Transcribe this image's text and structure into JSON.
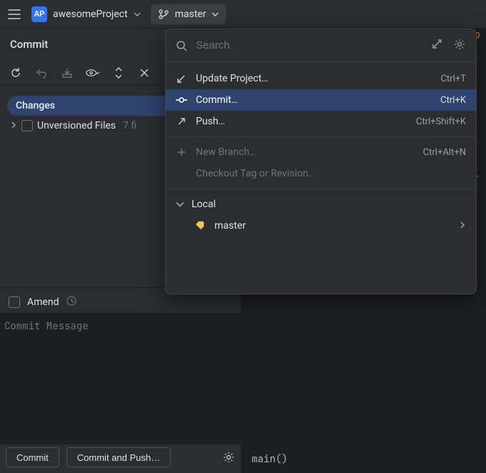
{
  "project": {
    "icon_text": "AP",
    "name": "awesomeProject"
  },
  "branch": {
    "name": "master"
  },
  "commit_panel": {
    "title": "Commit",
    "changes_label": "Changes",
    "unversioned_label": "Unversioned Files",
    "unversioned_count": "7 fi",
    "amend_label": "Amend",
    "message_placeholder": "Commit Message",
    "commit_btn": "Commit",
    "commit_push_btn": "Commit and Push…"
  },
  "popup": {
    "search_placeholder": "Search",
    "items": [
      {
        "icon": "update",
        "label": "Update Project…",
        "shortcut": "Ctrl+T"
      },
      {
        "icon": "commit",
        "label": "Commit…",
        "shortcut": "Ctrl+K",
        "selected": true
      },
      {
        "icon": "push",
        "label": "Push…",
        "shortcut": "Ctrl+Shift+K"
      }
    ],
    "new_branch": {
      "label": "New Branch…",
      "shortcut": "Ctrl+Alt+N"
    },
    "checkout_tag": "Checkout Tag or Revision…",
    "local_label": "Local",
    "local_branch": "master"
  },
  "editor": {
    "frag_right_top": "ro",
    "frag_green": ".L",
    "status": "main()"
  }
}
